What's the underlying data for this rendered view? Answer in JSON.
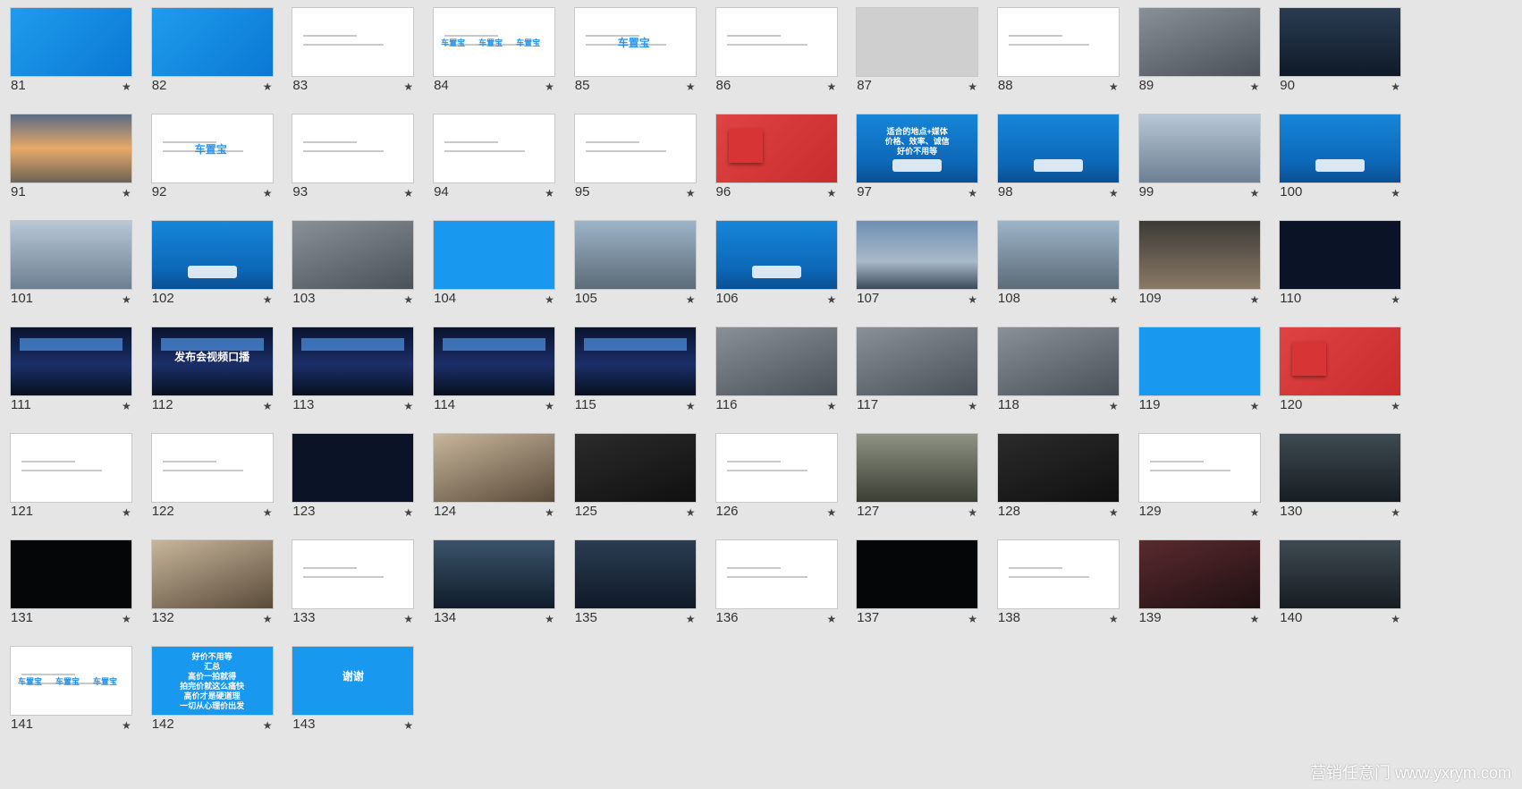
{
  "star_glyph": "★",
  "watermark": "营销任意门 www.yxrym.com",
  "slides": [
    {
      "n": "81",
      "style": "t-blue"
    },
    {
      "n": "82",
      "style": "t-blue"
    },
    {
      "n": "83",
      "style": "t-white"
    },
    {
      "n": "84",
      "style": "t-white"
    },
    {
      "n": "85",
      "style": "t-white"
    },
    {
      "n": "86",
      "style": "t-white"
    },
    {
      "n": "87",
      "style": "t-grey"
    },
    {
      "n": "88",
      "style": "t-white"
    },
    {
      "n": "89",
      "style": "t-photo"
    },
    {
      "n": "90",
      "style": "t-teal"
    },
    {
      "n": "91",
      "style": "t-sunset"
    },
    {
      "n": "92",
      "style": "t-white"
    },
    {
      "n": "93",
      "style": "t-white"
    },
    {
      "n": "94",
      "style": "t-white"
    },
    {
      "n": "95",
      "style": "t-white"
    },
    {
      "n": "96",
      "style": "t-red"
    },
    {
      "n": "97",
      "style": "t-ad"
    },
    {
      "n": "98",
      "style": "t-ad"
    },
    {
      "n": "99",
      "style": "t-airport"
    },
    {
      "n": "100",
      "style": "t-ad"
    },
    {
      "n": "101",
      "style": "t-airport"
    },
    {
      "n": "102",
      "style": "t-ad"
    },
    {
      "n": "103",
      "style": "t-photo"
    },
    {
      "n": "104",
      "style": "t-bblue"
    },
    {
      "n": "105",
      "style": "t-street"
    },
    {
      "n": "106",
      "style": "t-ad"
    },
    {
      "n": "107",
      "style": "t-sky"
    },
    {
      "n": "108",
      "style": "t-street"
    },
    {
      "n": "109",
      "style": "t-crowd"
    },
    {
      "n": "110",
      "style": "t-navy"
    },
    {
      "n": "111",
      "style": "t-stage"
    },
    {
      "n": "112",
      "style": "t-stage"
    },
    {
      "n": "113",
      "style": "t-stage"
    },
    {
      "n": "114",
      "style": "t-stage"
    },
    {
      "n": "115",
      "style": "t-stage"
    },
    {
      "n": "116",
      "style": "t-photo"
    },
    {
      "n": "117",
      "style": "t-photo"
    },
    {
      "n": "118",
      "style": "t-photo"
    },
    {
      "n": "119",
      "style": "t-bblue"
    },
    {
      "n": "120",
      "style": "t-red"
    },
    {
      "n": "121",
      "style": "t-white"
    },
    {
      "n": "122",
      "style": "t-white"
    },
    {
      "n": "123",
      "style": "t-navy"
    },
    {
      "n": "124",
      "style": "t-warm"
    },
    {
      "n": "125",
      "style": "t-dark"
    },
    {
      "n": "126",
      "style": "t-white"
    },
    {
      "n": "127",
      "style": "t-ground"
    },
    {
      "n": "128",
      "style": "t-dark"
    },
    {
      "n": "129",
      "style": "t-white"
    },
    {
      "n": "130",
      "style": "t-dusk"
    },
    {
      "n": "131",
      "style": "t-black"
    },
    {
      "n": "132",
      "style": "t-warm"
    },
    {
      "n": "133",
      "style": "t-white"
    },
    {
      "n": "134",
      "style": "t-lake"
    },
    {
      "n": "135",
      "style": "t-teal"
    },
    {
      "n": "136",
      "style": "t-white"
    },
    {
      "n": "137",
      "style": "t-black"
    },
    {
      "n": "138",
      "style": "t-white"
    },
    {
      "n": "139",
      "style": "t-rose"
    },
    {
      "n": "140",
      "style": "t-dusk"
    },
    {
      "n": "141",
      "style": "t-white"
    },
    {
      "n": "142",
      "style": "t-bblue"
    },
    {
      "n": "143",
      "style": "t-bblue"
    }
  ],
  "slide_text": {
    "85": "车置宝",
    "92": "车置宝",
    "97": [
      "适合的地点+媒体",
      "价格、效率、诚信",
      "好价不用等"
    ],
    "112": "发布会视频口播",
    "142": [
      "好价不用等",
      "汇总",
      "高价一拍就得",
      "拍完价就这么痛快",
      "高价才是硬道理",
      "一切从心理价出发"
    ],
    "143": "谢谢",
    "84": [
      "车置宝",
      "车置宝",
      "车置宝"
    ],
    "141": [
      "车置宝",
      "车置宝",
      "车置宝"
    ]
  }
}
